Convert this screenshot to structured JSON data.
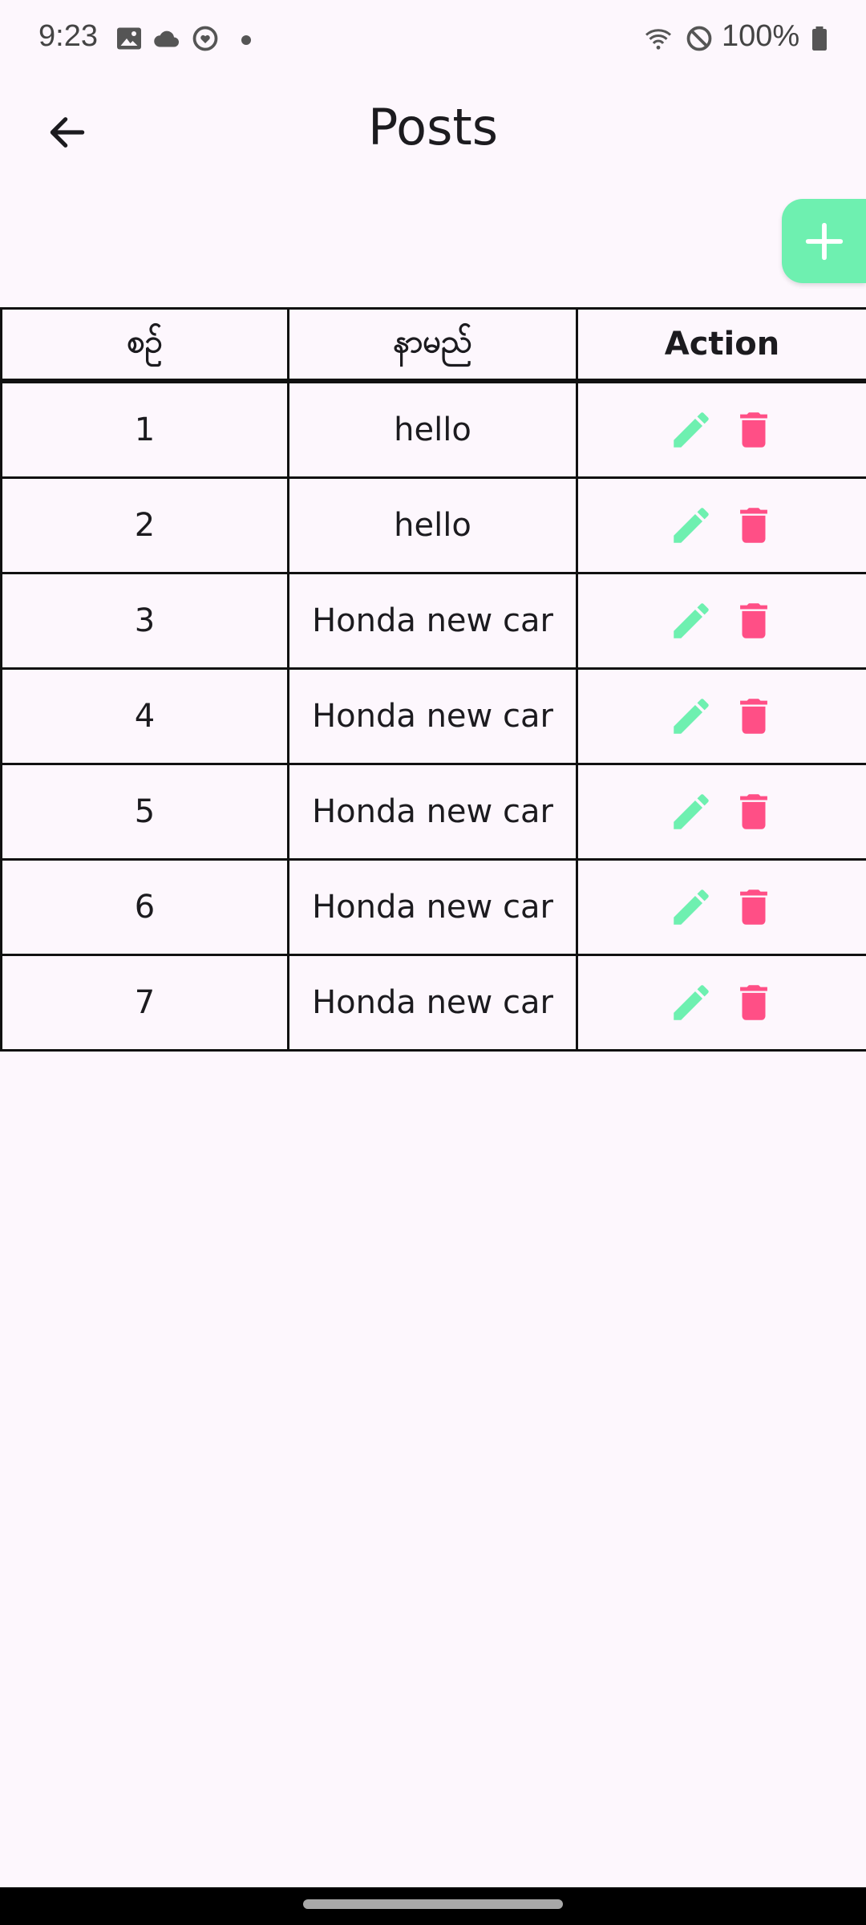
{
  "status_bar": {
    "time": "9:23",
    "battery": "100%"
  },
  "app_bar": {
    "title": "Posts",
    "back_icon": "arrow-back-icon"
  },
  "fab": {
    "icon": "plus-icon",
    "color": "#6ef0b0"
  },
  "table": {
    "headers": [
      "စဥ်",
      "နာမည်",
      "Action"
    ],
    "rows": [
      {
        "index": "1",
        "name": "hello"
      },
      {
        "index": "2",
        "name": "hello"
      },
      {
        "index": "3",
        "name": "Honda new car"
      },
      {
        "index": "4",
        "name": "Honda new car"
      },
      {
        "index": "5",
        "name": "Honda new car"
      },
      {
        "index": "6",
        "name": "Honda new car"
      },
      {
        "index": "7",
        "name": "Honda new car"
      }
    ],
    "edit_color": "#6ef0b0",
    "delete_color": "#ff4f86"
  }
}
